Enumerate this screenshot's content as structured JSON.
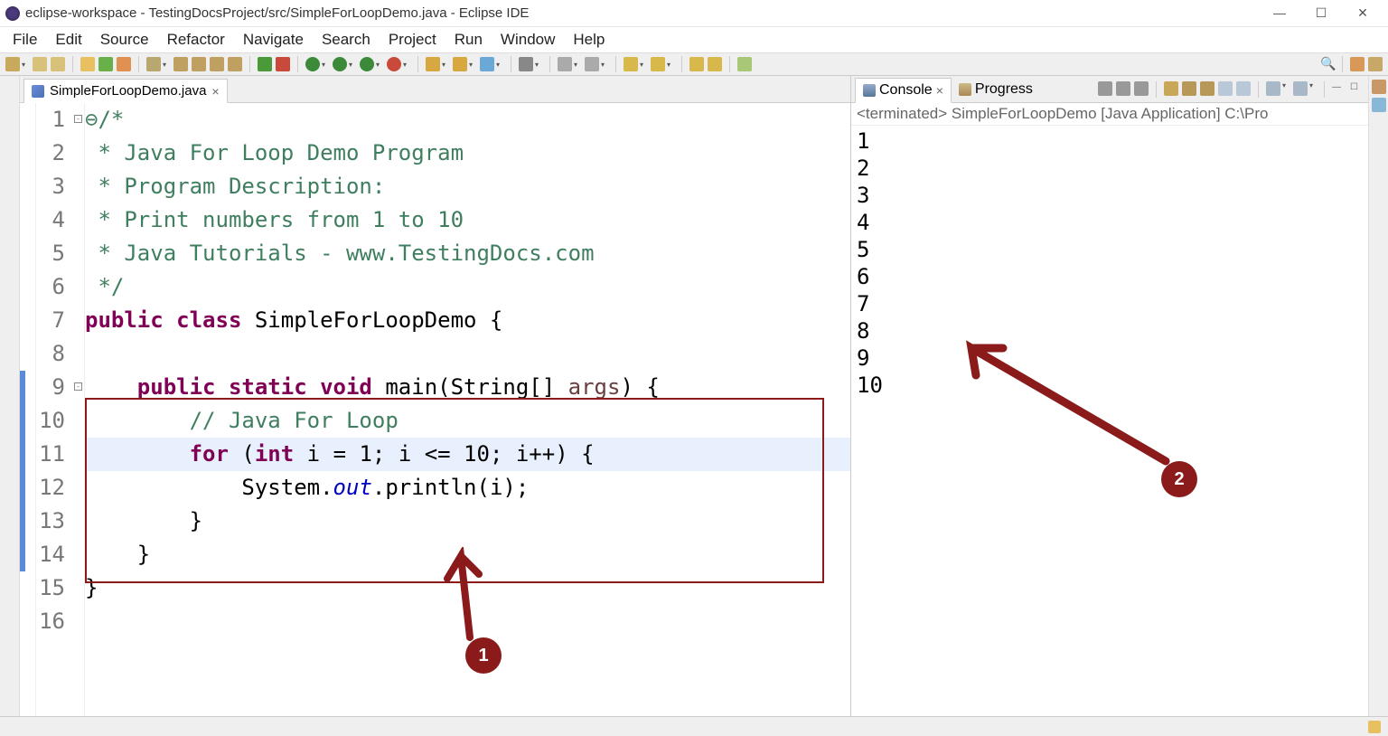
{
  "window": {
    "title": "eclipse-workspace - TestingDocsProject/src/SimpleForLoopDemo.java - Eclipse IDE"
  },
  "menu": [
    "File",
    "Edit",
    "Source",
    "Refactor",
    "Navigate",
    "Search",
    "Project",
    "Run",
    "Window",
    "Help"
  ],
  "editor": {
    "tab_title": "SimpleForLoopDemo.java",
    "lines": [
      {
        "n": 1,
        "segs": [
          [
            "⊖/*",
            "comment"
          ]
        ]
      },
      {
        "n": 2,
        "segs": [
          [
            " * Java For Loop Demo Program",
            "comment"
          ]
        ]
      },
      {
        "n": 3,
        "segs": [
          [
            " * Program Description:",
            "comment"
          ]
        ]
      },
      {
        "n": 4,
        "segs": [
          [
            " * Print numbers from 1 to 10",
            "comment"
          ]
        ]
      },
      {
        "n": 5,
        "segs": [
          [
            " * Java Tutorials - www.TestingDocs.com",
            "comment"
          ]
        ]
      },
      {
        "n": 6,
        "segs": [
          [
            " */",
            "comment"
          ]
        ]
      },
      {
        "n": 7,
        "segs": [
          [
            "public class",
            "keyword"
          ],
          [
            " SimpleForLoopDemo {",
            "text"
          ]
        ]
      },
      {
        "n": 8,
        "segs": [
          [
            "",
            "text"
          ]
        ]
      },
      {
        "n": 9,
        "segs": [
          [
            "    ",
            "text"
          ],
          [
            "public static void",
            "keyword"
          ],
          [
            " main(String[] ",
            "text"
          ],
          [
            "args",
            "arg"
          ],
          [
            ") {",
            "text"
          ]
        ]
      },
      {
        "n": 10,
        "segs": [
          [
            "        ",
            "text"
          ],
          [
            "// Java For Loop",
            "comment"
          ]
        ]
      },
      {
        "n": 11,
        "hl": true,
        "segs": [
          [
            "        ",
            "text"
          ],
          [
            "for",
            "keyword"
          ],
          [
            " (",
            "text"
          ],
          [
            "int",
            "keyword"
          ],
          [
            " i = 1; i <= 10; i++) {",
            "text"
          ]
        ]
      },
      {
        "n": 12,
        "segs": [
          [
            "            System.",
            "text"
          ],
          [
            "out",
            "field"
          ],
          [
            ".println(i);",
            "text"
          ]
        ]
      },
      {
        "n": 13,
        "segs": [
          [
            "        }",
            "text"
          ]
        ]
      },
      {
        "n": 14,
        "segs": [
          [
            "    }",
            "text"
          ]
        ]
      },
      {
        "n": 15,
        "segs": [
          [
            "}",
            "text"
          ]
        ]
      },
      {
        "n": 16,
        "segs": [
          [
            "",
            "text"
          ]
        ]
      }
    ]
  },
  "console": {
    "tab1": "Console",
    "tab2": "Progress",
    "header": "<terminated> SimpleForLoopDemo [Java Application] C:\\Pro",
    "output": [
      "1",
      "2",
      "3",
      "4",
      "5",
      "6",
      "7",
      "8",
      "9",
      "10"
    ]
  },
  "annotations": {
    "badge1": "1",
    "badge2": "2"
  }
}
